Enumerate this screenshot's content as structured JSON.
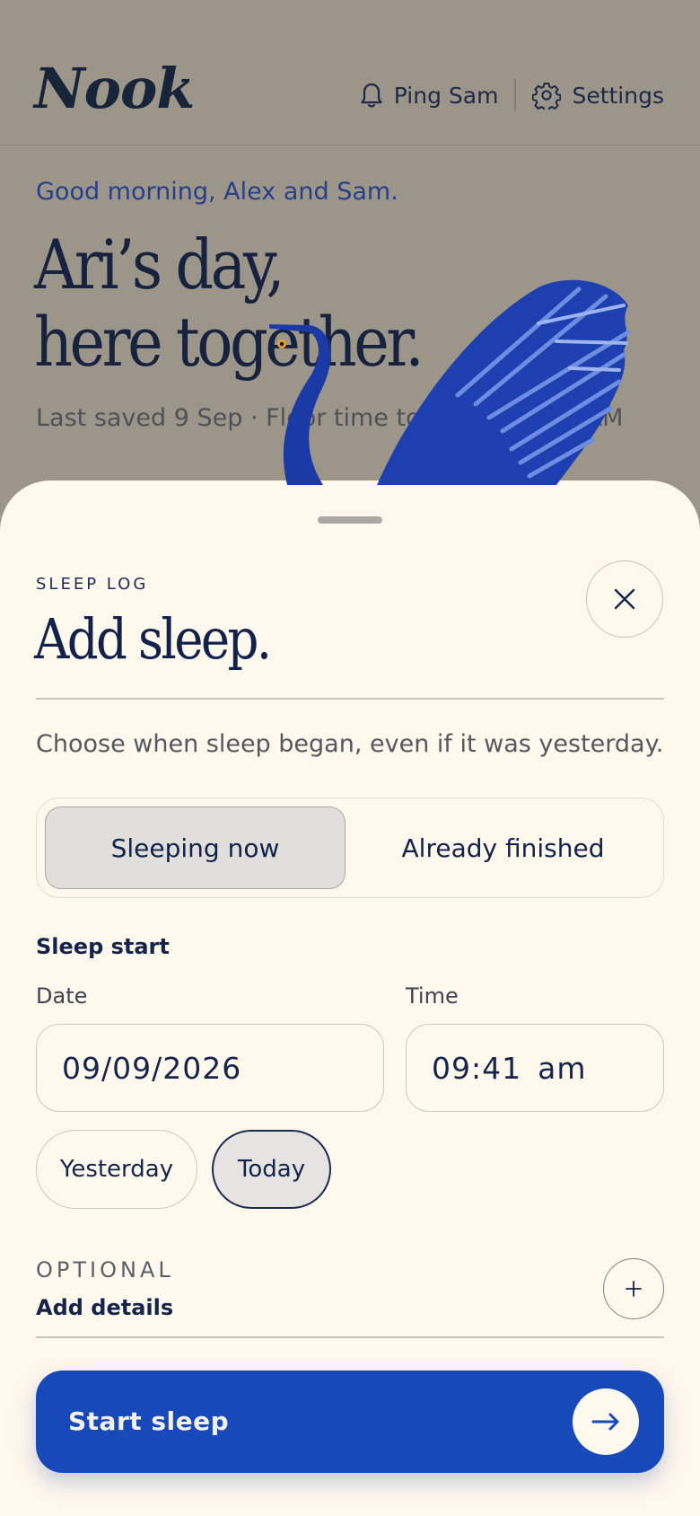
{
  "app": {
    "logo": "Nook",
    "header": {
      "ping_label": "Ping Sam",
      "settings_label": "Settings"
    },
    "greeting": "Good morning, Alex and Sam.",
    "hero_line1": "Ari’s day,",
    "hero_line2": "here together.",
    "saved_status": "Last saved 9 Sep · Floor time together · 9:11 AM"
  },
  "sheet": {
    "eyebrow": "SLEEP LOG",
    "title": "Add sleep.",
    "helper": "Choose when sleep began, even if it was yesterday.",
    "mode_options": [
      "Sleeping now",
      "Already finished"
    ],
    "mode_selected": "Sleeping now",
    "section_label": "Sleep start",
    "date_label": "Date",
    "date_value": "09/09/2026",
    "time_label": "Time",
    "time_value": "09:41",
    "time_period": "am",
    "quick_days": [
      "Yesterday",
      "Today"
    ],
    "quick_day_selected": "Today",
    "optional_label": "OPTIONAL",
    "add_details_label": "Add details",
    "primary_label": "Start sleep"
  },
  "icons": {
    "bell": "bell-icon",
    "gear": "gear-icon",
    "close": "close-icon",
    "plus": "plus-icon",
    "arrow": "arrow-right-icon"
  },
  "colors": {
    "accent": "#1849b8",
    "sheet_bg": "#fff8ec",
    "ink": "#14244a",
    "scrim_bg": "#9c968a"
  }
}
